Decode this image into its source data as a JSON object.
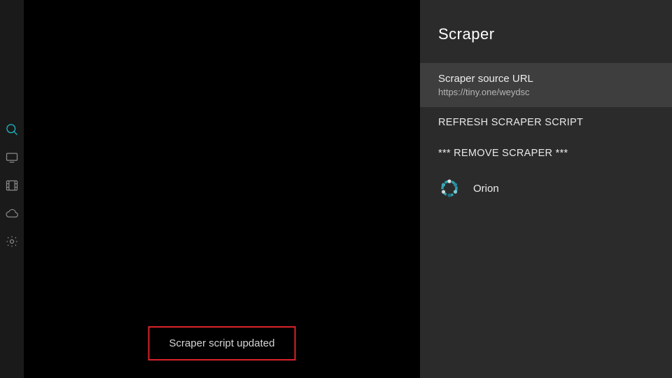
{
  "sidebar": {
    "items": [
      {
        "name": "search-icon",
        "active": true
      },
      {
        "name": "monitor-icon",
        "active": false
      },
      {
        "name": "film-icon",
        "active": false
      },
      {
        "name": "cloud-icon",
        "active": false
      },
      {
        "name": "gear-icon",
        "active": false
      }
    ]
  },
  "panel": {
    "title": "Scraper",
    "source": {
      "label": "Scraper source URL",
      "value": "https://tiny.one/weydsc"
    },
    "refresh_label": "REFRESH SCRAPER SCRIPT",
    "remove_label": "*** REMOVE SCRAPER ***",
    "orion_label": "Orion"
  },
  "toast": {
    "message": "Scraper script updated"
  },
  "colors": {
    "accent": "#1fb8c6",
    "alert_border": "#d8232a"
  }
}
